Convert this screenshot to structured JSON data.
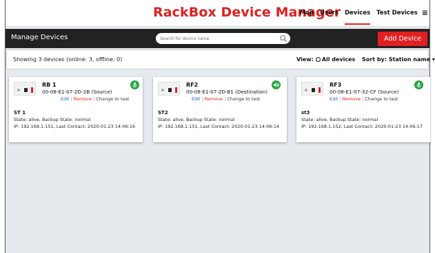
{
  "header": {
    "brand": "RackBox Device Manager",
    "nav": [
      "Map",
      "Users",
      "Devices",
      "Test Devices"
    ],
    "active_nav": "Devices"
  },
  "toolbar": {
    "title": "Manage Devices",
    "search_placeholder": "Search for device name",
    "add_label": "Add Device"
  },
  "status": {
    "showing": "Showing 3 devices (online: 3, offline: 0)",
    "view_label": "View:",
    "view_value": "All devices",
    "sort_label": "Sort by: Station name"
  },
  "devices": [
    {
      "name": "RB 1",
      "mac": "00-08-E1-07-2D-2B (Source)",
      "edit": "Edit",
      "remove": "Remove",
      "change": "Change to test",
      "icon": "microphone-icon",
      "station": "ST 1",
      "state": "State: alive, Backup State: normal",
      "ip": "IP: 192.168.1.151, Last Contact: 2020-01-23 14:06:16"
    },
    {
      "name": "RF2",
      "mac": "00-08-E1-07-2D-B1 (Destination)",
      "edit": "Edit",
      "remove": "Remove",
      "change": "Change to test",
      "icon": "speaker-icon",
      "station": "ST2",
      "state": "State: alive, Backup State: normal",
      "ip": "IP: 192.168.1.151, Last Contact: 2020-01-23 14:06:14"
    },
    {
      "name": "RF3",
      "mac": "00-08-E1-07-32-CF (Source)",
      "edit": "Edit",
      "remove": "Remove",
      "change": "Change to test",
      "icon": "microphone-icon",
      "station": "st3",
      "state": "State: alive, Backup State: normal",
      "ip": "IP: 192.168.1.152, Last Contact: 2020-01-23 14:06:17"
    }
  ],
  "colors": {
    "accent": "#e02020",
    "online": "#28a745",
    "dark_bar": "#222222",
    "background": "#e6eaef"
  }
}
